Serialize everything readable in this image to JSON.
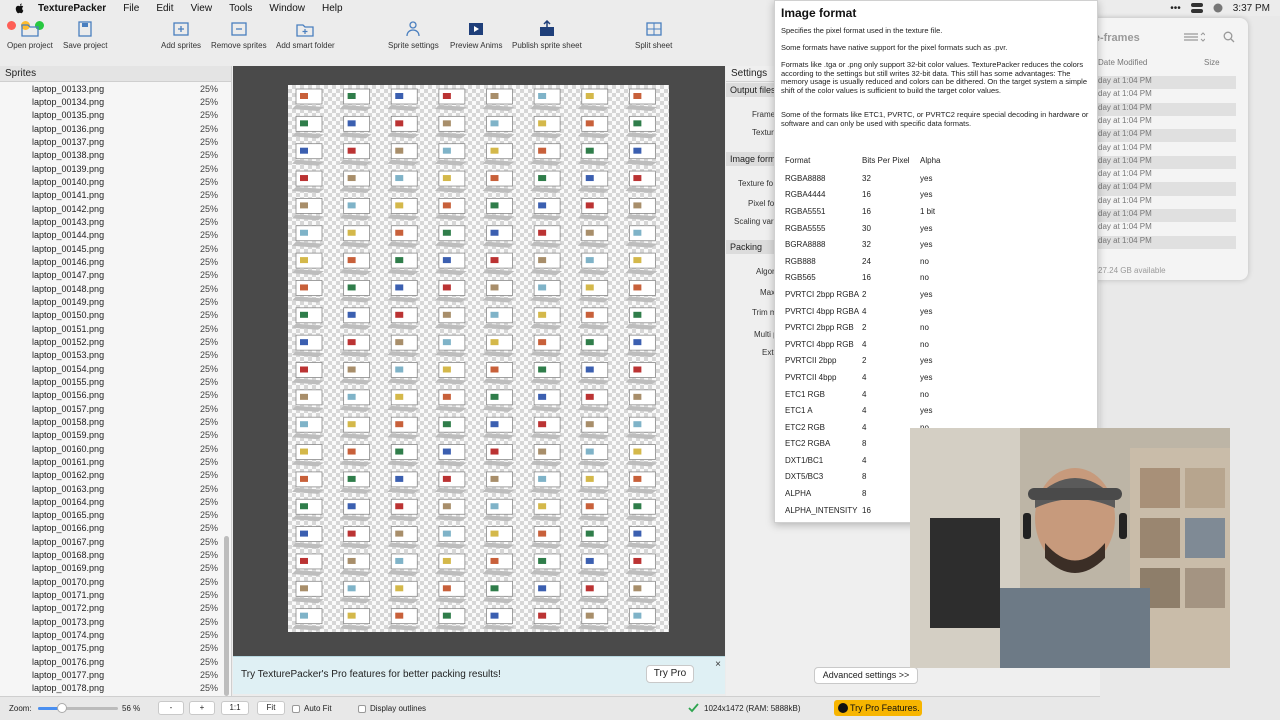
{
  "menubar": {
    "app": "TexturePacker",
    "items": [
      "File",
      "Edit",
      "View",
      "Tools",
      "Window",
      "Help"
    ],
    "clock": "3:37 PM"
  },
  "toolbar": {
    "open_project": "Open project",
    "save_project": "Save project",
    "add_sprites": "Add sprites",
    "remove_sprites": "Remove sprites",
    "add_smart_folder": "Add smart folder",
    "sprite_settings": "Sprite settings",
    "preview_anims": "Preview Anims",
    "publish_sprite_sheet": "Publish sprite sheet",
    "split_sheet": "Split sheet"
  },
  "sprites": {
    "header": "Sprites",
    "items": [
      {
        "name": "laptop_00133.png",
        "scale": "25%"
      },
      {
        "name": "laptop_00134.png",
        "scale": "25%"
      },
      {
        "name": "laptop_00135.png",
        "scale": "25%"
      },
      {
        "name": "laptop_00136.png",
        "scale": "25%"
      },
      {
        "name": "laptop_00137.png",
        "scale": "25%"
      },
      {
        "name": "laptop_00138.png",
        "scale": "25%"
      },
      {
        "name": "laptop_00139.png",
        "scale": "25%"
      },
      {
        "name": "laptop_00140.png",
        "scale": "25%"
      },
      {
        "name": "laptop_00141.png",
        "scale": "25%"
      },
      {
        "name": "laptop_00142.png",
        "scale": "25%"
      },
      {
        "name": "laptop_00143.png",
        "scale": "25%"
      },
      {
        "name": "laptop_00144.png",
        "scale": "25%"
      },
      {
        "name": "laptop_00145.png",
        "scale": "25%"
      },
      {
        "name": "laptop_00146.png",
        "scale": "25%"
      },
      {
        "name": "laptop_00147.png",
        "scale": "25%"
      },
      {
        "name": "laptop_00148.png",
        "scale": "25%"
      },
      {
        "name": "laptop_00149.png",
        "scale": "25%"
      },
      {
        "name": "laptop_00150.png",
        "scale": "25%"
      },
      {
        "name": "laptop_00151.png",
        "scale": "25%"
      },
      {
        "name": "laptop_00152.png",
        "scale": "25%"
      },
      {
        "name": "laptop_00153.png",
        "scale": "25%"
      },
      {
        "name": "laptop_00154.png",
        "scale": "25%"
      },
      {
        "name": "laptop_00155.png",
        "scale": "25%"
      },
      {
        "name": "laptop_00156.png",
        "scale": "25%"
      },
      {
        "name": "laptop_00157.png",
        "scale": "25%"
      },
      {
        "name": "laptop_00158.png",
        "scale": "25%"
      },
      {
        "name": "laptop_00159.png",
        "scale": "25%"
      },
      {
        "name": "laptop_00160.png",
        "scale": "25%"
      },
      {
        "name": "laptop_00161.png",
        "scale": "25%"
      },
      {
        "name": "laptop_00162.png",
        "scale": "25%"
      },
      {
        "name": "laptop_00163.png",
        "scale": "25%"
      },
      {
        "name": "laptop_00164.png",
        "scale": "25%"
      },
      {
        "name": "laptop_00165.png",
        "scale": "25%"
      },
      {
        "name": "laptop_00166.png",
        "scale": "25%"
      },
      {
        "name": "laptop_00167.png",
        "scale": "25%"
      },
      {
        "name": "laptop_00168.png",
        "scale": "25%"
      },
      {
        "name": "laptop_00169.png",
        "scale": "25%"
      },
      {
        "name": "laptop_00170.png",
        "scale": "25%"
      },
      {
        "name": "laptop_00171.png",
        "scale": "25%"
      },
      {
        "name": "laptop_00172.png",
        "scale": "25%"
      },
      {
        "name": "laptop_00173.png",
        "scale": "25%"
      },
      {
        "name": "laptop_00174.png",
        "scale": "25%"
      },
      {
        "name": "laptop_00175.png",
        "scale": "25%"
      },
      {
        "name": "laptop_00176.png",
        "scale": "25%"
      },
      {
        "name": "laptop_00177.png",
        "scale": "25%"
      },
      {
        "name": "laptop_00178.png",
        "scale": "25%"
      }
    ]
  },
  "banner": {
    "text": "Try TexturePacker's Pro features for better packing results!",
    "button": "Try Pro",
    "close": "×"
  },
  "settings": {
    "title": "Settings",
    "output_files": "Output files",
    "frame_label": "Frame",
    "texture_label": "Textur",
    "image_format": "Image forma",
    "texture_format_label": "Texture fo",
    "pixel_format_label": "Pixel fo",
    "scaling_label": "Scaling vari",
    "packing": "Packing",
    "algorithm_label": "Algor",
    "max_label": "Max",
    "trim_label": "Trim m",
    "multi_label": "Multi p",
    "extrude_label": "Ext",
    "advanced": "Advanced settings >>"
  },
  "statusbar": {
    "zoom_label": "Zoom:",
    "zoom_fraction": 0.3,
    "zoom_value": "56 %",
    "minus": "-",
    "plus": "+",
    "one_to_one": "1:1",
    "fit": "Fit",
    "auto_fit": "Auto Fit",
    "display_outlines": "Display outlines",
    "size_info": "1024x1472 (RAM: 5888kB)",
    "try_pro_features": "Try Pro Features."
  },
  "finder": {
    "title": "sprite-frames",
    "col_modified": "Date Modified",
    "col_size": "Size",
    "rows": [
      "day at 1:04 PM",
      "day at 1:04 PM",
      "day at 1:04 PM",
      "day at 1:04 PM",
      "day at 1:04 PM",
      "day at 1:04 PM",
      "day at 1:04 PM",
      "day at 1:04 PM",
      "day at 1:04 PM",
      "day at 1:04 PM",
      "day at 1:04 PM",
      "day at 1:04 PM",
      "day at 1:04 PM"
    ],
    "footer": "27.24 GB available"
  },
  "tooltip": {
    "title": "Image format",
    "p1": "Specifies the pixel format used in the texture file.",
    "p2": "Some formats have native support for the pixel formats such as .pvr.",
    "p3": "Formats like .tga or .png only support 32-bit color values. TexturePacker reduces the colors according to the settings but still writes 32-bit data. This still has some advantages: The memory usage is usually reduced and colors can be dithered. On the target system a simple shift of the color values is sufficient to build the target color values.",
    "p4": "Some of the formats like ETC1, PVRTC, or PVRTC2 require special decoding in hardware or software and can only be used with specific data formats.",
    "headers": [
      "Format",
      "Bits Per Pixel",
      "Alpha"
    ],
    "rows": [
      [
        "RGBA8888",
        "32",
        "yes"
      ],
      [
        "RGBA4444",
        "16",
        "yes"
      ],
      [
        "RGBA5551",
        "16",
        "1 bit"
      ],
      [
        "RGBA5555",
        "30",
        "yes"
      ],
      [
        "BGRA8888",
        "32",
        "yes"
      ],
      [
        "RGB888",
        "24",
        "no"
      ],
      [
        "RGB565",
        "16",
        "no"
      ],
      [
        "PVRTCI 2bpp RGBA",
        "2",
        "yes"
      ],
      [
        "PVRTCI 4bpp RGBA",
        "4",
        "yes"
      ],
      [
        "PVRTCI 2bpp RGB",
        "2",
        "no"
      ],
      [
        "PVRTCI 4bpp RGB",
        "4",
        "no"
      ],
      [
        "PVRTCII 2bpp",
        "2",
        "yes"
      ],
      [
        "PVRTCII 4bpp",
        "4",
        "yes"
      ],
      [
        "ETC1 RGB",
        "4",
        "no"
      ],
      [
        "ETC1 A",
        "4",
        "yes"
      ],
      [
        "ETC2 RGB",
        "4",
        "no"
      ],
      [
        "ETC2 RGBA",
        "8",
        ""
      ],
      [
        "DXT1/BC1",
        "4",
        ""
      ],
      [
        "DXT5/BC3",
        "8",
        ""
      ],
      [
        "ALPHA",
        "8",
        ""
      ],
      [
        "ALPHA_INTENSITY",
        "16",
        ""
      ]
    ]
  },
  "colors": {
    "accent": "#4a8ff0",
    "pro_yellow": "#f7b500",
    "banner_bg": "#dff0f4"
  }
}
